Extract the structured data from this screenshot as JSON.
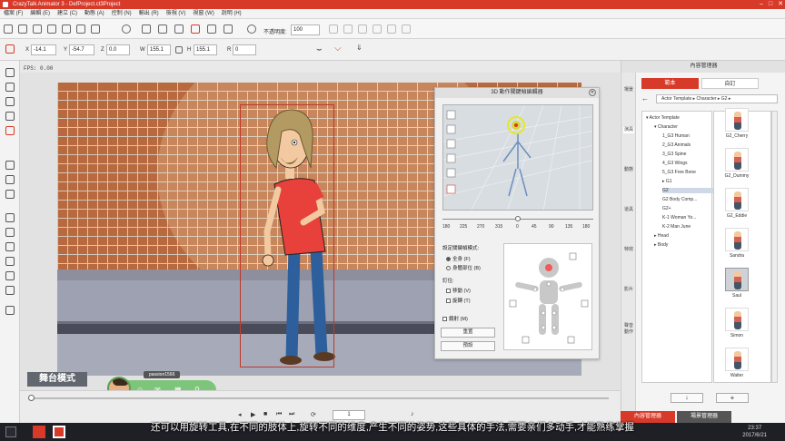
{
  "window": {
    "title": "CrazyTalk Animator 3 - DefProject.ct3Project"
  },
  "menu": [
    "檔案 (F)",
    "編輯 (E)",
    "建立 (C)",
    "動態 (A)",
    "控制 (N)",
    "輸出 (R)",
    "檢視 (V)",
    "視窗 (W)",
    "說明 (H)"
  ],
  "toolbar": {
    "opacity_label": "不透明度:",
    "opacity_value": "100"
  },
  "transform": {
    "x_label": "X",
    "x": "-14.1",
    "y_label": "Y",
    "y": "-54.7",
    "z_label": "Z",
    "z": "0.0",
    "w_label": "W",
    "w": "155.1",
    "h_label": "H",
    "h": "155.1",
    "r_label": "R",
    "r": "0"
  },
  "fps": "FPS: 0.00",
  "editor": {
    "title": "3D 動作關鍵幀編輯器",
    "ruler": [
      "180",
      "225",
      "270",
      "315",
      "0",
      "45",
      "90",
      "135",
      "180"
    ],
    "mode_label": "設定關鍵幀模式:",
    "mode_full": "全身 (F)",
    "mode_part": "身體部位 (B)",
    "lock_label": "釘住:",
    "lock_move": "移動 (V)",
    "lock_rotate": "旋轉 (T)",
    "mirror": "鏡射 (M)",
    "reset": "重置",
    "preset": "預設"
  },
  "stage": {
    "mode_label": "舞台模式",
    "user_tag": "passion1566"
  },
  "timeline": {
    "frame": "1"
  },
  "content_manager": {
    "title": "內容管理器",
    "tabs": [
      "範本",
      "自訂"
    ],
    "breadcrumb": "Actor Template ▸ Character ▸ G2 ▸",
    "side_tabs": [
      "場景",
      "演員",
      "動態",
      "道具",
      "特效",
      "影片",
      "聲音動作"
    ],
    "tree": [
      {
        "label": "Actor Template",
        "indent": 0,
        "expander": "▾"
      },
      {
        "label": "Character",
        "indent": 1,
        "expander": "▾"
      },
      {
        "label": "1_G3 Human",
        "indent": 2,
        "expander": ""
      },
      {
        "label": "2_G3 Animals",
        "indent": 2,
        "expander": ""
      },
      {
        "label": "3_G3 Spine",
        "indent": 2,
        "expander": ""
      },
      {
        "label": "4_G3 Wings",
        "indent": 2,
        "expander": ""
      },
      {
        "label": "5_G3 Free Bone",
        "indent": 2,
        "expander": ""
      },
      {
        "label": "G1",
        "indent": 2,
        "expander": "▸"
      },
      {
        "label": "G2",
        "indent": 2,
        "expander": "",
        "selected": true
      },
      {
        "label": "G2 Body Comp...",
        "indent": 2,
        "expander": ""
      },
      {
        "label": "G2+",
        "indent": 2,
        "expander": ""
      },
      {
        "label": "K-1 Woman Yo...",
        "indent": 2,
        "expander": ""
      },
      {
        "label": "K-2 Man June",
        "indent": 2,
        "expander": ""
      },
      {
        "label": "Head",
        "indent": 1,
        "expander": "▸"
      },
      {
        "label": "Body",
        "indent": 1,
        "expander": "▸"
      }
    ],
    "thumbs": [
      "G2_Cherry",
      "G2_Dummy",
      "G2_Eddie",
      "Sandra",
      "Saul",
      "Simon",
      "Walter"
    ],
    "bottom_tabs": [
      "內容管理器",
      "場景管理器"
    ]
  },
  "subtitle": "还可以用旋转工具,在不同的肢体上,旋转不同的维度,产生不同的姿势,这些具体的手法,需要亲们多动手,才能熟练掌握",
  "clock": {
    "time": "23:37",
    "date": "2017/6/21"
  },
  "colors": {
    "accent": "#d83a2a",
    "shirt": "#e8403a",
    "pants": "#2d5f9c",
    "hair": "#b39a62"
  }
}
